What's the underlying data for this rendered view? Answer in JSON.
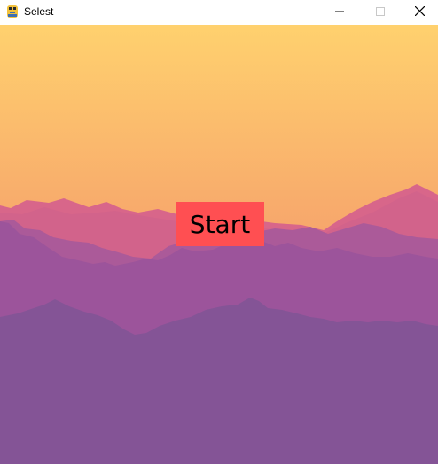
{
  "window": {
    "title": "Selest",
    "app_icon": "python-snake-icon",
    "controls": [
      "minimize-icon",
      "maximize-icon",
      "close-icon"
    ]
  },
  "scene": {
    "background": "mountain-sunset",
    "colors": {
      "sky_top": "#ffd16e",
      "sky_bottom": "#ec7f6f",
      "far_mountains": "#d8668a",
      "mid_mountains": "#ab5a99",
      "near_mountains": "#9c549b",
      "front_mountains": "#845496"
    }
  },
  "start_button": {
    "label": "Start",
    "background": "#ff4f52"
  }
}
